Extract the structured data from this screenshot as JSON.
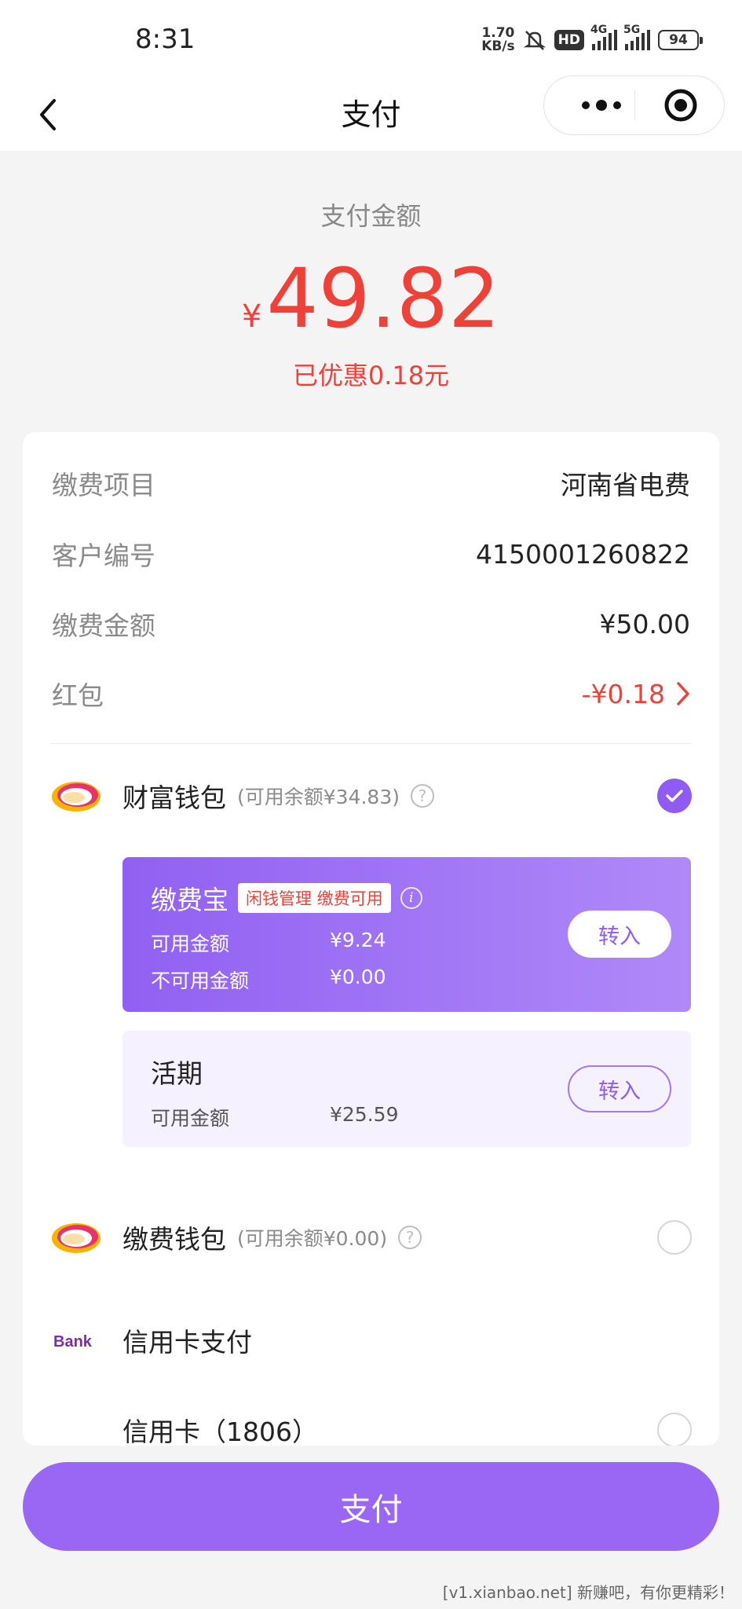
{
  "status_bar": {
    "time": "8:31",
    "net_speed_value": "1.70",
    "net_speed_unit": "KB/s",
    "hd_label": "HD",
    "signal1_label": "4G",
    "signal2_label": "5G",
    "battery": "94"
  },
  "navbar": {
    "title": "支付"
  },
  "payment": {
    "label": "支付金额",
    "currency": "¥",
    "amount": "49.82",
    "discount_text": "已优惠0.18元"
  },
  "details": {
    "rows": [
      {
        "label": "缴费项目",
        "value": "河南省电费"
      },
      {
        "label": "客户编号",
        "value": "4150001260822"
      },
      {
        "label": "缴费金额",
        "value": "¥50.00"
      },
      {
        "label": "红包",
        "value": "-¥0.18"
      }
    ]
  },
  "wallets": {
    "fortune": {
      "name": "财富钱包",
      "available": "(可用余额¥34.83)",
      "help": "?"
    },
    "jiaofeibao": {
      "title": "缴费宝",
      "tag": "闲钱管理 缴费可用",
      "info": "i",
      "available_label": "可用金额",
      "available_value": "¥9.24",
      "unavailable_label": "不可用金额",
      "unavailable_value": "¥0.00",
      "button": "转入"
    },
    "huoqi": {
      "title": "活期",
      "available_label": "可用金额",
      "available_value": "¥25.59",
      "button": "转入"
    },
    "fee_wallet": {
      "name": "缴费钱包",
      "available": "(可用余额¥0.00)",
      "help": "?"
    },
    "credit_card_section": {
      "logo_text": "Bank",
      "name": "信用卡支付"
    },
    "credit_card": {
      "name": "信用卡（1806）"
    }
  },
  "pay_button": {
    "label": "支付"
  },
  "watermark": "[v1.xianbao.net] 新赚吧，有你更精彩！",
  "colors": {
    "accent": "#8f5bf2",
    "price_red": "#f04138",
    "pay_button": "#9a67f4"
  }
}
